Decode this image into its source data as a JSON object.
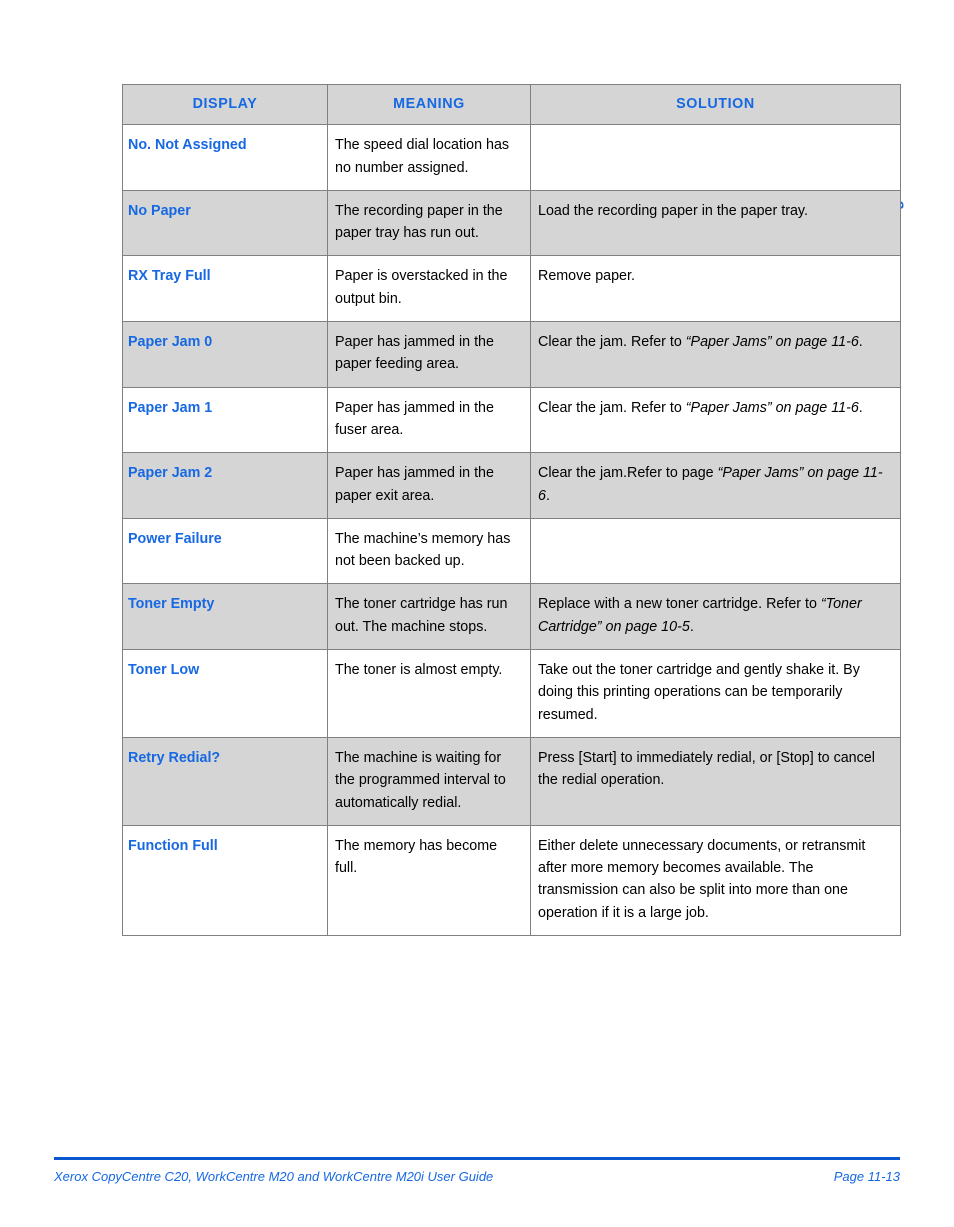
{
  "side_tab": {
    "label": "Troubleshooting"
  },
  "table": {
    "headers": {
      "display": "DISPLAY",
      "meaning": "MEANING",
      "solution": "SOLUTION"
    },
    "rows": [
      {
        "display": "No. Not Assigned",
        "meaning": "The speed dial location has no number assigned.",
        "solution_pre": "",
        "solution_ref": "",
        "solution_post": ""
      },
      {
        "display": "No Paper",
        "meaning": "The recording paper in the paper tray has run out.",
        "solution_pre": "Load the recording paper in the paper tray.",
        "solution_ref": "",
        "solution_post": ""
      },
      {
        "display": "RX Tray Full",
        "meaning": "Paper is overstacked in the output bin.",
        "solution_pre": "Remove paper.",
        "solution_ref": "",
        "solution_post": ""
      },
      {
        "display": "Paper Jam 0",
        "meaning": "Paper has jammed in the paper feeding area.",
        "solution_pre": "Clear the jam. Refer to ",
        "solution_ref": "“Paper Jams” on page 11-6",
        "solution_post": "."
      },
      {
        "display": "Paper Jam 1",
        "meaning": "Paper has jammed in the fuser area.",
        "solution_pre": "Clear the jam. Refer to ",
        "solution_ref": "“Paper Jams” on page 11-6",
        "solution_post": "."
      },
      {
        "display": "Paper Jam 2",
        "meaning": "Paper has jammed in the paper exit area.",
        "solution_pre": "Clear the jam.Refer to page ",
        "solution_ref": "“Paper Jams” on page 11-6",
        "solution_post": "."
      },
      {
        "display": "Power Failure",
        "meaning": "The machine’s memory has not been backed up.",
        "solution_pre": "",
        "solution_ref": "",
        "solution_post": ""
      },
      {
        "display": "Toner Empty",
        "meaning": "The toner cartridge has run out. The machine stops.",
        "solution_pre": "Replace with a new toner cartridge. Refer to ",
        "solution_ref": "“Toner Cartridge” on page 10-5",
        "solution_post": "."
      },
      {
        "display": "Toner Low",
        "meaning": "The toner is almost empty.",
        "solution_pre": "Take out the toner cartridge and gently shake it. By doing this printing operations can be temporarily resumed.",
        "solution_ref": "",
        "solution_post": ""
      },
      {
        "display": "Retry Redial?",
        "meaning": "The machine is waiting for the programmed interval to automatically redial.",
        "solution_pre": "Press [Start] to immediately redial, or [Stop] to cancel the redial operation.",
        "solution_ref": "",
        "solution_post": ""
      },
      {
        "display": "Function Full",
        "meaning": "The memory has become full.",
        "solution_pre": "Either delete unnecessary documents, or retransmit after more memory becomes available. The transmission can also be split into more than one operation if it is a large job.",
        "solution_ref": "",
        "solution_post": ""
      }
    ]
  },
  "footer": {
    "guide_title": "Xerox CopyCentre C20, WorkCentre M20 and WorkCentre M20i User Guide",
    "page_number": "Page 11-13"
  },
  "colors": {
    "accent_blue": "#1668e3",
    "rule_blue": "#0a57d0",
    "row_shade": "#d5d5d5",
    "border_gray": "#808080"
  }
}
